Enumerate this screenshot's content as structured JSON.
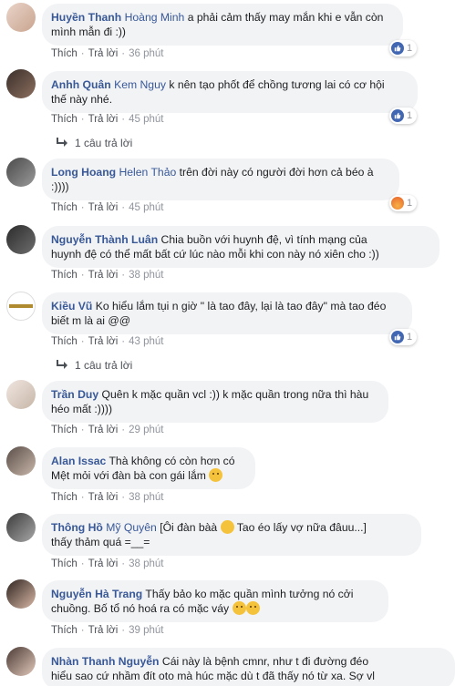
{
  "ui": {
    "like_label": "Thích",
    "reply_label": "Trả lời",
    "separator": "·"
  },
  "colors": {
    "author": "#385898",
    "bubble": "#f2f3f5",
    "meta": "#90949c",
    "like_badge": "#4267b2"
  },
  "comments": [
    {
      "author": "Huyền Thanh",
      "mention": "Hoàng Minh",
      "text_line1": "a phải cảm thấy may mắn khi e vẫn còn",
      "text_line2": "mình mẫn đi :))",
      "time": "36 phút",
      "reaction_count": "1",
      "reaction_type": "like-icon"
    },
    {
      "author": "Anhh Quân",
      "mention": "Kem Nguy",
      "text_line1": "k nên tạo phốt để chồng tương lai có cơ hội",
      "text_line2": "thế này nhé.",
      "time": "45 phút",
      "reaction_count": "1",
      "reaction_type": "like-icon",
      "replies": "1 câu trả lời"
    },
    {
      "author": "Long Hoang",
      "mention": "Helen Thảo",
      "text_line1": "trên đời này có người đời hơn cả béo à",
      "text_line2": ":))))",
      "time": "45 phút",
      "reaction_count": "1",
      "reaction_type": "angry-icon"
    },
    {
      "author": "Nguyễn Thành Luân",
      "mention": "",
      "text_line1": "Chia buồn với huynh đệ, vì tính mạng của",
      "text_line2": "huynh đệ có thể mất bất cứ lúc nào mỗi khi con này nó xiên cho :))",
      "time": "38 phút"
    },
    {
      "author": "Kiều Vũ",
      "mention": "",
      "text_line1": "Ko hiểu lắm tụi n giờ \" là tao đây, lại là tao đây\" mà tao đéo",
      "text_line2": "biết m là ai @@",
      "time": "43 phút",
      "reaction_count": "1",
      "reaction_type": "like-icon",
      "replies": "1 câu trả lời"
    },
    {
      "author": "Trần Duy",
      "mention": "",
      "text_line1": "Quên k mặc quần vcl :)) k mặc quần trong nữa thì hàu",
      "text_line2": "héo mất :))))",
      "time": "29 phút"
    },
    {
      "author": "Alan Issac",
      "mention": "",
      "text_line1": "Thà không có còn hơn có",
      "text_line2": "Mệt mỏi với đàn bà con gái lắm",
      "time": "38 phút"
    },
    {
      "author": "Thông Hồ",
      "mention": "Mỹ Quyên",
      "text_line1": "[Ôi đàn bàà",
      "text_line1b": "Tao éo lấy vợ nữa đâuu...]",
      "text_line2": "thấy thảm quá =__=",
      "time": "38 phút"
    },
    {
      "author": "Nguyễn Hà Trang",
      "mention": "",
      "text_line1": "Thấy bảo ko mặc quần mình tưởng nó cởi",
      "text_line2": "chuồng. Bố tổ nó hoá ra có mặc váy",
      "time": "39 phút"
    },
    {
      "author": "Nhàn Thanh Nguyễn",
      "mention": "",
      "text_line1": "Cái này là bệnh cmnr, như t đi đường đéo",
      "text_line2": "hiểu sao cứ nhầm đít oto mà húc mặc dù t đã thấy nó từ xa. Sợ vl"
    }
  ]
}
